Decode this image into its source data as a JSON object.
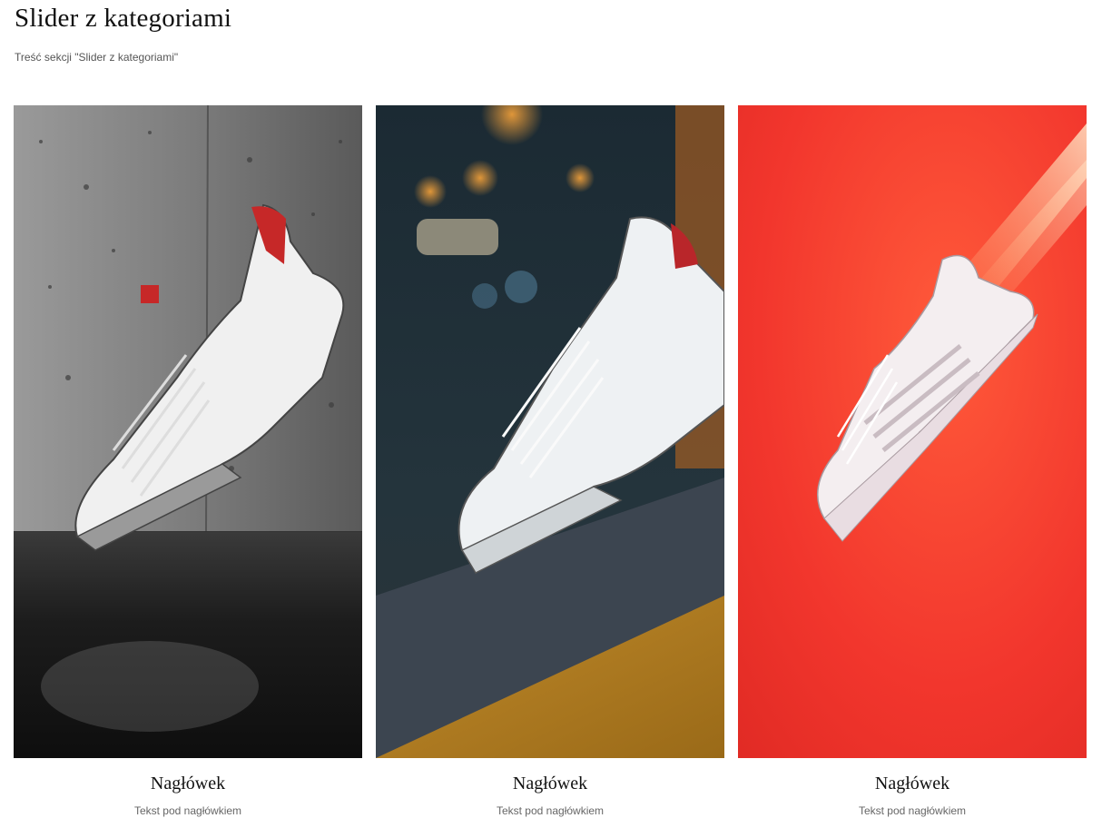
{
  "section": {
    "title": "Slider z kategoriami",
    "subtitle": "Treść sekcji \"Slider z kategoriami\""
  },
  "cards": [
    {
      "heading": "Nagłówek",
      "text": "Tekst pod nagłówkiem",
      "image": "white-sneaker-concrete-wall-photo"
    },
    {
      "heading": "Nagłówek",
      "text": "Tekst pod nagłówkiem",
      "image": "white-sneaker-city-night-bokeh-photo"
    },
    {
      "heading": "Nagłówek",
      "text": "Tekst pod nagłówkiem",
      "image": "white-sneaker-red-background-photo"
    }
  ]
}
